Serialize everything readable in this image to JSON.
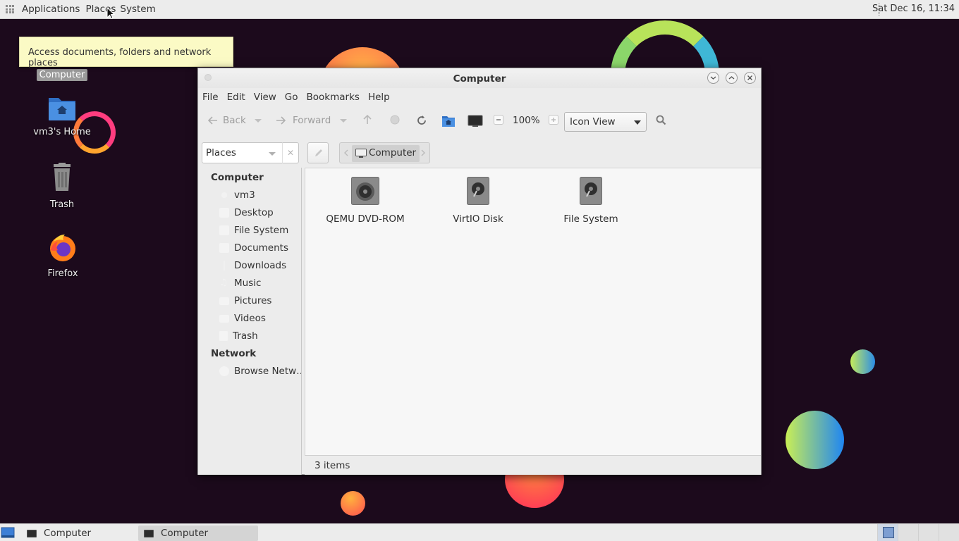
{
  "top_panel": {
    "applications_label": "Applications",
    "places_label": "Places",
    "system_label": "System",
    "clock": "Sat Dec 16, 11:34"
  },
  "tooltip": {
    "text": "Access documents, folders and network places"
  },
  "desktop": {
    "icons": [
      {
        "label": "Computer",
        "icon": "computer-icon"
      },
      {
        "label": "vm3's Home",
        "icon": "home-folder-icon"
      },
      {
        "label": "Trash",
        "icon": "trash-icon"
      },
      {
        "label": "Firefox",
        "icon": "firefox-icon"
      }
    ]
  },
  "window": {
    "title": "Computer",
    "menu": [
      "File",
      "Edit",
      "View",
      "Go",
      "Bookmarks",
      "Help"
    ],
    "toolbar": {
      "back_label": "Back",
      "forward_label": "Forward",
      "zoom": "100%",
      "view_mode": "Icon View"
    },
    "location": {
      "places_select": "Places",
      "breadcrumb": "Computer"
    },
    "sidebar": {
      "sections": [
        {
          "heading": "Computer",
          "items": [
            "vm3",
            "Desktop",
            "File System",
            "Documents",
            "Downloads",
            "Music",
            "Pictures",
            "Videos",
            "Trash"
          ]
        },
        {
          "heading": "Network",
          "items": [
            "Browse Netw…"
          ]
        }
      ]
    },
    "files": [
      {
        "label": "QEMU DVD-ROM",
        "icon": "optical-drive-icon"
      },
      {
        "label": "VirtIO Disk",
        "icon": "hard-disk-icon"
      },
      {
        "label": "File System",
        "icon": "hard-disk-icon"
      }
    ],
    "status": "3 items"
  },
  "taskbar": {
    "tasks": [
      "Computer",
      "Computer"
    ]
  },
  "colors": {
    "desktop_bg": "#1c0a1c",
    "panel_bg": "#ececec",
    "tooltip_bg": "#fbfac5",
    "accent_blue": "#3d7fd6"
  }
}
